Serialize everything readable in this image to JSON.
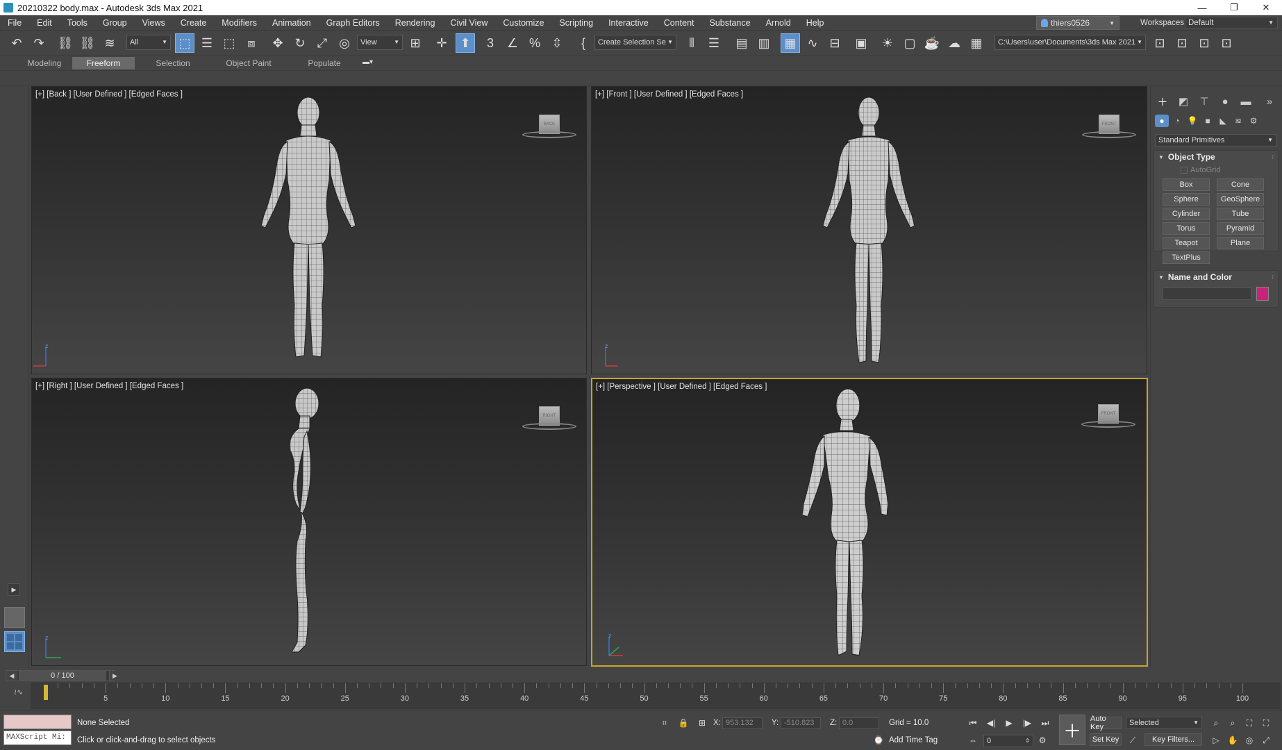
{
  "window": {
    "title": "20210322 body.max - Autodesk 3ds Max 2021",
    "minimize": "—",
    "restore": "❐",
    "close": "✕"
  },
  "menu": [
    "File",
    "Edit",
    "Tools",
    "Group",
    "Views",
    "Create",
    "Modifiers",
    "Animation",
    "Graph Editors",
    "Rendering",
    "Civil View",
    "Customize",
    "Scripting",
    "Interactive",
    "Content",
    "Substance",
    "Arnold",
    "Help"
  ],
  "user": {
    "name": "thiers0526"
  },
  "workspace": {
    "label": "Workspaces:",
    "value": "Default"
  },
  "toolbar": {
    "filter": "All",
    "ref_coord": "View",
    "named_selection": "Create Selection Se",
    "project_path": "C:\\Users\\user\\Documents\\3ds Max 2021"
  },
  "ribbon_tabs": [
    "Modeling",
    "Freeform",
    "Selection",
    "Object Paint",
    "Populate"
  ],
  "viewports": {
    "back": {
      "label": "[+] [Back ] [User Defined ] [Edged Faces ]",
      "cube": "BACK"
    },
    "front": {
      "label": "[+] [Front ] [User Defined ] [Edged Faces ]",
      "cube": "FRONT"
    },
    "right": {
      "label": "[+] [Right ] [User Defined ] [Edged Faces ]",
      "cube": "RIGHT"
    },
    "perspective": {
      "label": "[+] [Perspective ] [User Defined ] [Edged Faces ]",
      "cube": "FRONT"
    }
  },
  "command_panel": {
    "category": "Standard Primitives",
    "object_type_title": "Object Type",
    "autogrid": "AutoGrid",
    "objects": [
      "Box",
      "Cone",
      "Sphere",
      "GeoSphere",
      "Cylinder",
      "Tube",
      "Torus",
      "Pyramid",
      "Teapot",
      "Plane",
      "TextPlus"
    ],
    "name_color_title": "Name and Color",
    "swatch_color": "#c8237a"
  },
  "timeline": {
    "slider": "0 / 100",
    "ticks": [
      5,
      10,
      15,
      20,
      25,
      30,
      35,
      40,
      45,
      50,
      55,
      60,
      65,
      70,
      75,
      80,
      85,
      90,
      95,
      100
    ]
  },
  "status": {
    "selection": "None Selected",
    "prompt": "Click or click-and-drag to select objects",
    "maxscript": "MAXScript Mi:",
    "x_label": "X:",
    "x": "953.132",
    "y_label": "Y:",
    "y": "-510.823",
    "z_label": "Z:",
    "z": "0.0",
    "grid": "Grid = 10.0",
    "add_time_tag": "Add Time Tag",
    "auto_key": "Auto Key",
    "set_key": "Set Key",
    "key_mode": "Selected",
    "key_filters": "Key Filters...",
    "frame": "0"
  },
  "colors": {
    "active_viewport_border": "#c9a52b",
    "selected_tool": "#5c8fc9",
    "accent_pink": "#c8237a"
  }
}
